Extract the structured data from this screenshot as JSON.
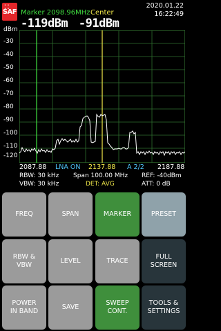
{
  "header": {
    "logo_text": "SAF",
    "marker_readout": "Marker 2098.96MHz",
    "center_label": "Center",
    "marker_level": "-119dBm",
    "center_level": "-91dBm",
    "date": "2020.01.22",
    "time": "16:22:49"
  },
  "plot": {
    "unit_label": "dBm",
    "y_ticks": [
      "-30",
      "-40",
      "-50",
      "-60",
      "-70",
      "-80",
      "-90",
      "-100",
      "-110",
      "-120"
    ],
    "colors": {
      "trace": "#ffffff",
      "grid": "#2f6f2f",
      "marker": "#41e041",
      "center": "#f2e94a"
    }
  },
  "freq": {
    "start": "2087.88",
    "lna": "LNA ON",
    "center": "2137.88",
    "page": "A 2/2",
    "stop": "2187.88"
  },
  "params": {
    "rbw": "RBW: 30 kHz",
    "span": "Span 100.00 MHz",
    "ref": "REF: -40dBm",
    "vbw": "VBW: 30 kHz",
    "det": "DET: AVG",
    "att": "ATT:  0 dB"
  },
  "buttons": {
    "freq": "FREQ",
    "span": "SPAN",
    "marker": "MARKER",
    "preset": "PRESET",
    "rbw_vbw": "RBW &\nVBW",
    "level": "LEVEL",
    "trace": "TRACE",
    "full_screen": "FULL\nSCREEN",
    "power_in_band": "POWER\nIN BAND",
    "save": "SAVE",
    "sweep_cont": "SWEEP\nCONT.",
    "tools_settings": "TOOLS &\nSETTINGS"
  }
}
